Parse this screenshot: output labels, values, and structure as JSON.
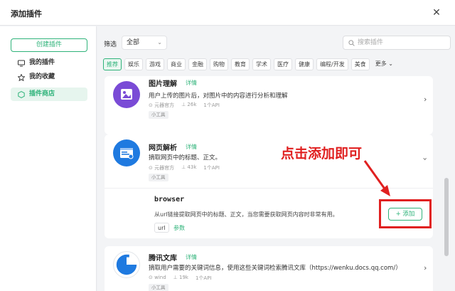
{
  "dialog": {
    "title": "添加插件",
    "close_icon": "close-icon"
  },
  "sidebar": {
    "create_button": "创建插件",
    "items": [
      {
        "label": "我的插件",
        "icon": "monitor-icon"
      },
      {
        "label": "我的收藏",
        "icon": "star-icon"
      },
      {
        "label": "插件商店",
        "icon": "cube-icon",
        "active": true
      }
    ]
  },
  "filter": {
    "label": "筛选",
    "selected": "全部",
    "search_placeholder": "搜索插件",
    "tags": [
      "推荐",
      "娱乐",
      "游戏",
      "商业",
      "金融",
      "购物",
      "教育",
      "学术",
      "医疗",
      "健康",
      "编程/开发",
      "美食"
    ],
    "more_label": "更多"
  },
  "plugins": [
    {
      "name": "图片理解",
      "detail_label": "详情",
      "description": "用户上传的图片后，对图片中的内容进行分析和理解",
      "author": "元器官方",
      "uses": "26k",
      "api_count": "1个API",
      "badge": "小工具"
    },
    {
      "name": "网页解析",
      "detail_label": "详情",
      "description": "摘取网页中的标题、正文。",
      "author": "元器官方",
      "uses": "43k",
      "api_count": "1个API",
      "badge": "小工具",
      "tool": {
        "name": "browser",
        "description": "从url链接提取网页中的标题、正文，当您需要获取网页内容时非常有用。",
        "param": "url",
        "param_link": "参数",
        "add_button": "+ 添加"
      }
    },
    {
      "name": "腾讯文库",
      "detail_label": "详情",
      "description": "摘取用户需要的关键词信息，使用这些关键词检索腾讯文库（https://wenku.docs.qq.com/）",
      "author": "wind",
      "uses": "19k",
      "api_count": "1个API",
      "badge": "小工具"
    }
  ],
  "annotation": {
    "text": "点击添加即可"
  },
  "colors": {
    "accent": "#2fb37a",
    "annotation": "#e02020"
  }
}
